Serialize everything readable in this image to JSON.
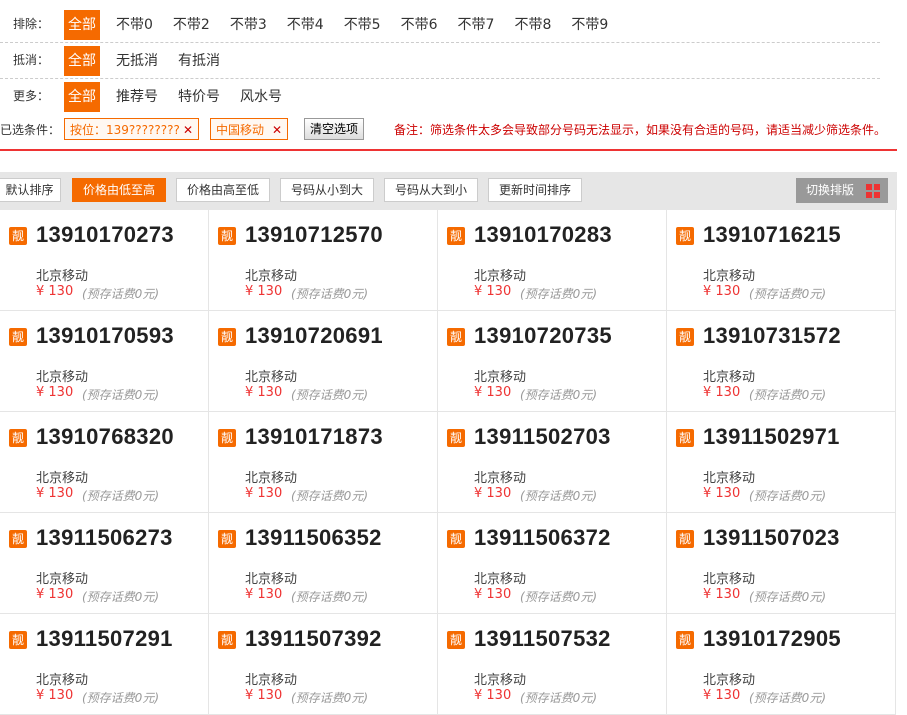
{
  "filters": {
    "exclude": {
      "label": "排除：",
      "options": [
        "全部",
        "不带0",
        "不带2",
        "不带3",
        "不带4",
        "不带5",
        "不带6",
        "不带7",
        "不带8",
        "不带9"
      ]
    },
    "deduct": {
      "label": "抵消：",
      "options": [
        "全部",
        "无抵消",
        "有抵消"
      ]
    },
    "more": {
      "label": "更多：",
      "options": [
        "全部",
        "推荐号",
        "特价号",
        "风水号"
      ]
    }
  },
  "selected": {
    "label": "已选条件：",
    "chips": [
      "按位：139????????",
      "中国移动"
    ],
    "clear_label": "清空选项",
    "note": "备注：筛选条件太多会导致部分号码无法显示，如果没有合适的号码，请适当减少筛选条件。"
  },
  "sort": {
    "buttons": [
      "默认排序",
      "价格由低至高",
      "价格由高至低",
      "号码从小到大",
      "号码从大到小",
      "更新时间排序"
    ],
    "switch_label": "切换排版"
  },
  "colors": {
    "accent": "#f56a00",
    "alert": "#e33333"
  },
  "numbers": [
    {
      "badge": "靓",
      "number": "13910170273",
      "carrier": "北京移动",
      "price": "¥ 130",
      "deposit": "(预存话费0元)"
    },
    {
      "badge": "靓",
      "number": "13910712570",
      "carrier": "北京移动",
      "price": "¥ 130",
      "deposit": "(预存话费0元)"
    },
    {
      "badge": "靓",
      "number": "13910170283",
      "carrier": "北京移动",
      "price": "¥ 130",
      "deposit": "(预存话费0元)"
    },
    {
      "badge": "靓",
      "number": "13910716215",
      "carrier": "北京移动",
      "price": "¥ 130",
      "deposit": "(预存话费0元)"
    },
    {
      "badge": "靓",
      "number": "13910170593",
      "carrier": "北京移动",
      "price": "¥ 130",
      "deposit": "(预存话费0元)"
    },
    {
      "badge": "靓",
      "number": "13910720691",
      "carrier": "北京移动",
      "price": "¥ 130",
      "deposit": "(预存话费0元)"
    },
    {
      "badge": "靓",
      "number": "13910720735",
      "carrier": "北京移动",
      "price": "¥ 130",
      "deposit": "(预存话费0元)"
    },
    {
      "badge": "靓",
      "number": "13910731572",
      "carrier": "北京移动",
      "price": "¥ 130",
      "deposit": "(预存话费0元)"
    },
    {
      "badge": "靓",
      "number": "13910768320",
      "carrier": "北京移动",
      "price": "¥ 130",
      "deposit": "(预存话费0元)"
    },
    {
      "badge": "靓",
      "number": "13910171873",
      "carrier": "北京移动",
      "price": "¥ 130",
      "deposit": "(预存话费0元)"
    },
    {
      "badge": "靓",
      "number": "13911502703",
      "carrier": "北京移动",
      "price": "¥ 130",
      "deposit": "(预存话费0元)"
    },
    {
      "badge": "靓",
      "number": "13911502971",
      "carrier": "北京移动",
      "price": "¥ 130",
      "deposit": "(预存话费0元)"
    },
    {
      "badge": "靓",
      "number": "13911506273",
      "carrier": "北京移动",
      "price": "¥ 130",
      "deposit": "(预存话费0元)"
    },
    {
      "badge": "靓",
      "number": "13911506352",
      "carrier": "北京移动",
      "price": "¥ 130",
      "deposit": "(预存话费0元)"
    },
    {
      "badge": "靓",
      "number": "13911506372",
      "carrier": "北京移动",
      "price": "¥ 130",
      "deposit": "(预存话费0元)"
    },
    {
      "badge": "靓",
      "number": "13911507023",
      "carrier": "北京移动",
      "price": "¥ 130",
      "deposit": "(预存话费0元)"
    },
    {
      "badge": "靓",
      "number": "13911507291",
      "carrier": "北京移动",
      "price": "¥ 130",
      "deposit": "(预存话费0元)"
    },
    {
      "badge": "靓",
      "number": "13911507392",
      "carrier": "北京移动",
      "price": "¥ 130",
      "deposit": "(预存话费0元)"
    },
    {
      "badge": "靓",
      "number": "13911507532",
      "carrier": "北京移动",
      "price": "¥ 130",
      "deposit": "(预存话费0元)"
    },
    {
      "badge": "靓",
      "number": "13910172905",
      "carrier": "北京移动",
      "price": "¥ 130",
      "deposit": "(预存话费0元)"
    }
  ]
}
